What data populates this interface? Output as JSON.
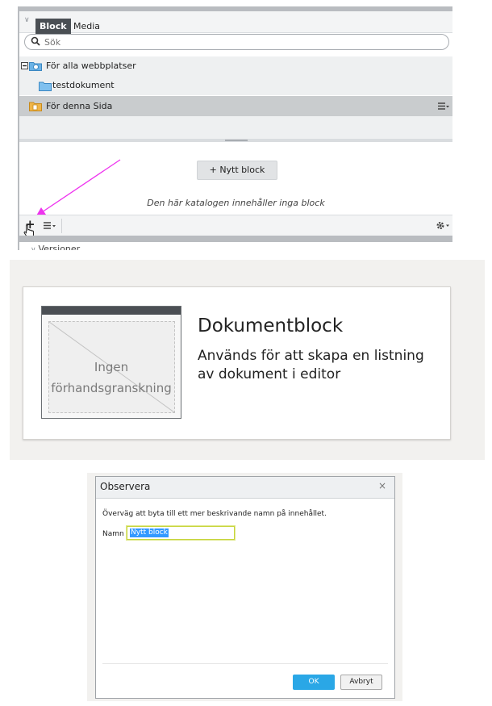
{
  "gadget": {
    "tabs": {
      "active": "Block",
      "other": "Media"
    },
    "search": {
      "placeholder": "Sök"
    },
    "tree": [
      {
        "label": "För alla webbplatser"
      },
      {
        "label": "testdokument"
      },
      {
        "label": "För denna Sida"
      }
    ],
    "new_block_label": "+ Nytt block",
    "empty_message": "Den här katalogen innehåller inga block",
    "versions_label": "Versioner"
  },
  "preview": {
    "thumbnail_text_line1": "Ingen",
    "thumbnail_text_line2": "förhandsgranskning",
    "title": "Dokumentblock",
    "description": "Används för att skapa en listning av dokument i editor"
  },
  "dialog": {
    "title": "Observera",
    "close": "×",
    "message": "Överväg att byta till ett mer beskrivande namn på innehållet.",
    "name_label": "Namn",
    "name_value": "Nytt block",
    "ok_label": "OK",
    "cancel_label": "Avbryt"
  },
  "colors": {
    "annotation_arrow": "#ee33ee",
    "ok_button": "#2aa7e6",
    "selected_row": "#c9ccce"
  },
  "icons": [
    "search-icon",
    "folder-icon",
    "site-folder-icon",
    "page-folder-icon",
    "context-menu-icon",
    "plus-icon",
    "list-menu-icon",
    "gear-icon",
    "hand-cursor-icon",
    "close-icon"
  ]
}
